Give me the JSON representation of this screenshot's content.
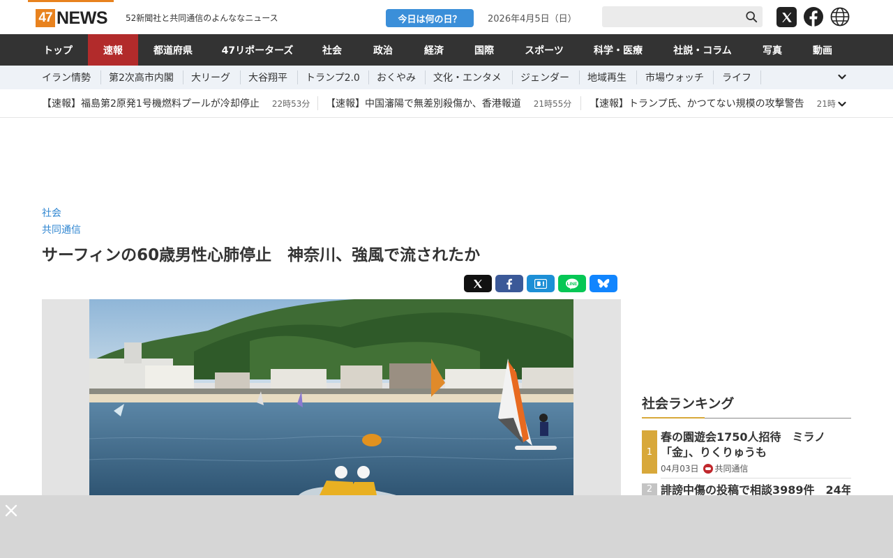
{
  "header": {
    "logo_num": "47",
    "logo_word": "NEWS",
    "tagline": "52新聞社と共同通信のよんななニュース",
    "today_button": "今日は何の日？",
    "date": "2026年4月5日（日）",
    "search_placeholder": ""
  },
  "main_nav": [
    "トップ",
    "速報",
    "都道府県",
    "47リポーターズ",
    "社会",
    "政治",
    "経済",
    "国際",
    "スポーツ",
    "科学・医療",
    "社説・コラム",
    "写真",
    "動画"
  ],
  "sub_nav": [
    "イラン情勢",
    "第2次高市内閣",
    "大リーグ",
    "大谷翔平",
    "トランプ2.0",
    "おくやみ",
    "文化・エンタメ",
    "ジェンダー",
    "地域再生",
    "市場ウォッチ",
    "ライフ"
  ],
  "ticker": [
    {
      "title": "【速報】福島第2原発1号機燃料プールが冷却停止",
      "time": "22時53分"
    },
    {
      "title": "【速報】中国瀋陽で無差別殺傷か、香港報道",
      "time": "21時55分"
    },
    {
      "title": "【速報】トランプ氏、かつてない規模の攻撃警告",
      "time": "21時"
    }
  ],
  "article": {
    "category": "社会",
    "source": "共同通信",
    "title": "サーフィンの60歳男性心肺停止　神奈川、強風で流されたか"
  },
  "share_buttons": [
    {
      "name": "share-x-button",
      "color": "#111111"
    },
    {
      "name": "share-facebook-button",
      "color": "#3b5998"
    },
    {
      "name": "share-hatena-button",
      "color": "#1d8fd6"
    },
    {
      "name": "share-line-button",
      "color": "#06c755"
    },
    {
      "name": "share-bluesky-button",
      "color": "#1185fe"
    }
  ],
  "sidebar": {
    "heading": "社会ランキング",
    "rankings": [
      {
        "rank": "1",
        "title": "春の園遊会1750人招待　ミラノ「金」、りくりゅうも",
        "date": "04月03日",
        "source": "共同通信"
      },
      {
        "rank": "2",
        "title": "誹謗中傷の投稿で相談3989件　24年",
        "date": "",
        "source": ""
      }
    ]
  },
  "colors": {
    "accent": "#e8821e",
    "nav_bg": "#333333",
    "nav_active": "#b22b2b",
    "link": "#2f86d1",
    "rank_gold": "#d8a83a"
  }
}
